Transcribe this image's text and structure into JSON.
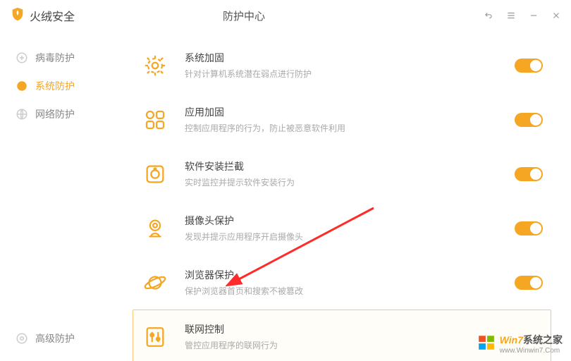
{
  "app": {
    "name": "火绒安全",
    "title": "防护中心"
  },
  "sidebar": {
    "items": [
      {
        "label": "病毒防护"
      },
      {
        "label": "系统防护"
      },
      {
        "label": "网络防护"
      }
    ],
    "advanced": "高级防护"
  },
  "rows": [
    {
      "title": "系统加固",
      "desc": "针对计算机系统潜在弱点进行防护",
      "toggle": true
    },
    {
      "title": "应用加固",
      "desc": "控制应用程序的行为，防止被恶意软件利用",
      "toggle": true
    },
    {
      "title": "软件安装拦截",
      "desc": "实时监控并提示软件安装行为",
      "toggle": true
    },
    {
      "title": "摄像头保护",
      "desc": "发现并提示应用程序开启摄像头",
      "toggle": true
    },
    {
      "title": "浏览器保护",
      "desc": "保护浏览器首页和搜索不被篡改",
      "toggle": true
    },
    {
      "title": "联网控制",
      "desc": "管控应用程序的联网行为",
      "toggle": null
    }
  ],
  "watermark": {
    "line1a": "Win7",
    "line1b": "系统之家",
    "line2": "www.Winwin7.Com"
  }
}
